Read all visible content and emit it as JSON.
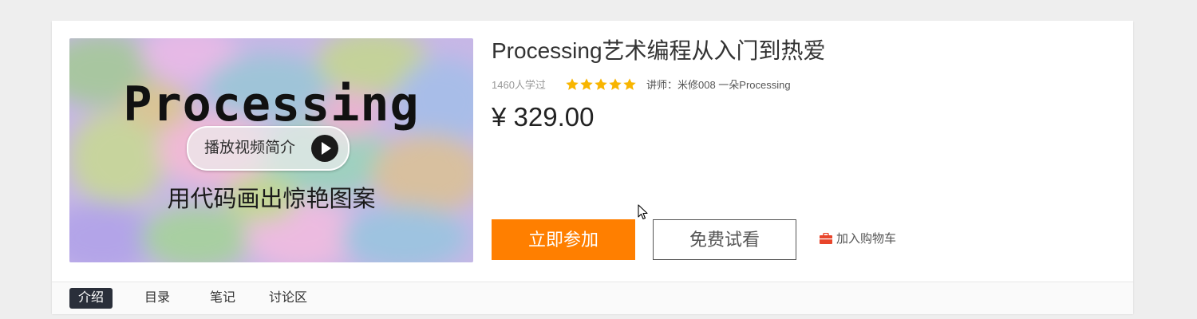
{
  "course": {
    "title": "Processing艺术编程从入门到热爱",
    "learners": "1460人学过",
    "rating": 5,
    "rating_max": 5,
    "teacher": "讲师：米修008 一朵Processing",
    "price": "¥ 329.00"
  },
  "cover": {
    "title": "Processing",
    "play_label": "播放视频简介",
    "subtitle": "用代码画出惊艳图案"
  },
  "actions": {
    "join_label": "立即参加",
    "trial_label": "免费试看",
    "cart_label": "加入购物车"
  },
  "tabs": [
    {
      "label": "介绍",
      "active": true
    },
    {
      "label": "目录",
      "active": false
    },
    {
      "label": "笔记",
      "active": false
    },
    {
      "label": "讨论区",
      "active": false
    }
  ],
  "colors": {
    "accent": "#ff7f00",
    "star": "#f8b500",
    "cart_icon": "#e8452b",
    "active_tab_bg": "#2a2f3a"
  },
  "icons": {
    "play": "play-icon",
    "star": "star-icon",
    "cart": "shopping-bag-icon",
    "cursor": "mouse-cursor-icon"
  }
}
